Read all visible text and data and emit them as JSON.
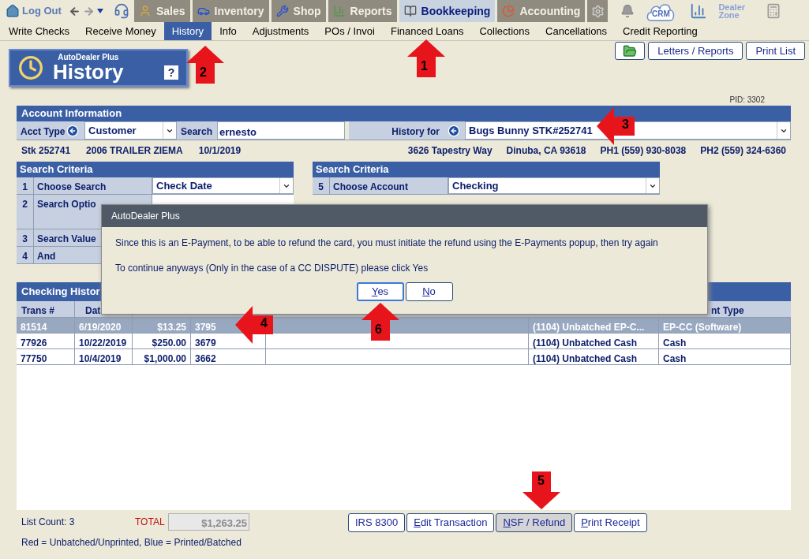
{
  "top_nav": {
    "logout": "Log Out",
    "tabs": [
      {
        "label": "Sales",
        "kind": "sales",
        "selected": false
      },
      {
        "label": "Inventory",
        "kind": "inventory",
        "selected": false
      },
      {
        "label": "Shop",
        "kind": "shop",
        "selected": false
      },
      {
        "label": "Reports",
        "kind": "reports",
        "selected": false
      },
      {
        "label": "Bookkeeping",
        "kind": "bookkeeping",
        "selected": true
      },
      {
        "label": "Accounting",
        "kind": "accounting",
        "selected": false
      }
    ],
    "crm": "CRM",
    "dealer_zone": "Dealer Zone"
  },
  "sub_menu": [
    {
      "label": "Write Checks",
      "selected": false
    },
    {
      "label": "Receive Money",
      "selected": false
    },
    {
      "label": "History",
      "selected": true
    },
    {
      "label": "Info",
      "selected": false
    },
    {
      "label": "Adjustments",
      "selected": false
    },
    {
      "label": "POs / Invoi",
      "selected": false
    },
    {
      "label": "Financed Loans",
      "selected": false
    },
    {
      "label": "Collections",
      "selected": false
    },
    {
      "label": "Cancellations",
      "selected": false
    },
    {
      "label": "Credit Reporting",
      "selected": false
    }
  ],
  "header": {
    "brand": "AutoDealer Plus",
    "title": "History",
    "help": "?"
  },
  "toolbar_buttons": [
    "Letters / Reports",
    "Print List"
  ],
  "pid": "PID: 3302",
  "account_information": {
    "title": "Account Information",
    "acct_type_label": "Acct Type",
    "acct_type": "Customer",
    "search_label": "Search",
    "search_value": "ernesto",
    "history_for_label": "History for",
    "history_for": "Bugs Bunny  STK#252741"
  },
  "account_details": {
    "left": [
      "Stk 252741",
      "2006 TRAILER ZIEMA",
      "10/1/2019"
    ],
    "right": [
      "3626 Tapestry Way",
      "Dinuba, CA 93618",
      "PH1 (559) 930-8038",
      "PH2 (559) 324-6360"
    ]
  },
  "search_criteria_left": {
    "title": "Search Criteria",
    "rows": [
      {
        "number": "1",
        "label": "Choose Search",
        "value": "Check Date",
        "kind": "dropdown"
      },
      {
        "number": "2",
        "label": "Search Optio",
        "kind": "tall"
      },
      {
        "number": "3",
        "label": "Search Value",
        "kind": "plain"
      },
      {
        "number": "4",
        "label": "And",
        "kind": "plain"
      }
    ]
  },
  "search_criteria_right": {
    "title": "Search Criteria",
    "rows": [
      {
        "number": "5",
        "label": "Choose Account",
        "value": "Checking",
        "kind": "dropdown"
      }
    ]
  },
  "history": {
    "title": "Checking Histor",
    "header_cells": [
      "Trans #",
      "Dat",
      "nt Type"
    ],
    "rows": [
      {
        "selected": true,
        "trans": "81514",
        "date": "6/19/2020",
        "amount": "$13.25",
        "check": "3795",
        "account": "(1104) Unbatched EP-C...",
        "type": "EP-CC (Software)"
      },
      {
        "selected": false,
        "trans": "77926",
        "date": "10/22/2019",
        "amount": "$250.00",
        "check": "3679",
        "account": "(1104) Unbatched Cash",
        "type": "Cash"
      },
      {
        "selected": false,
        "trans": "77750",
        "date": "10/4/2019",
        "amount": "$1,000.00",
        "check": "3662",
        "account": "(1104) Unbatched Cash",
        "type": "Cash"
      }
    ]
  },
  "footer": {
    "list_count": "List Count: 3",
    "total_label": "TOTAL",
    "total": "$1,263.25",
    "legend": "Red = Unbatched/Unprinted, Blue = Printed/Batched",
    "buttons": [
      {
        "label": "IRS 8300",
        "underline_first": false,
        "pressed": false
      },
      {
        "label": "Edit Transaction",
        "underline_first": true,
        "pressed": false
      },
      {
        "label": "NSF / Refund",
        "underline_first": true,
        "pressed": true
      },
      {
        "label": "Print Receipt",
        "underline_first": true,
        "pressed": false
      }
    ]
  },
  "dialog": {
    "title": "AutoDealer Plus",
    "messages": [
      "Since this is an E-Payment, to be able to refund the card, you must initiate the refund using the E-Payments popup, then try again",
      "To continue anyways (Only in the case of a CC DISPUTE) please click Yes"
    ],
    "buttons": [
      {
        "label": "Yes",
        "underline_first": true,
        "selected": true
      },
      {
        "label": "No",
        "underline_first": true,
        "selected": false
      }
    ]
  },
  "annotations": [
    {
      "label": "1",
      "kind": "up"
    },
    {
      "label": "2",
      "kind": "up"
    },
    {
      "label": "3",
      "kind": "left"
    },
    {
      "label": "4",
      "kind": "left"
    },
    {
      "label": "5",
      "kind": "down"
    },
    {
      "label": "6",
      "kind": "up"
    }
  ]
}
